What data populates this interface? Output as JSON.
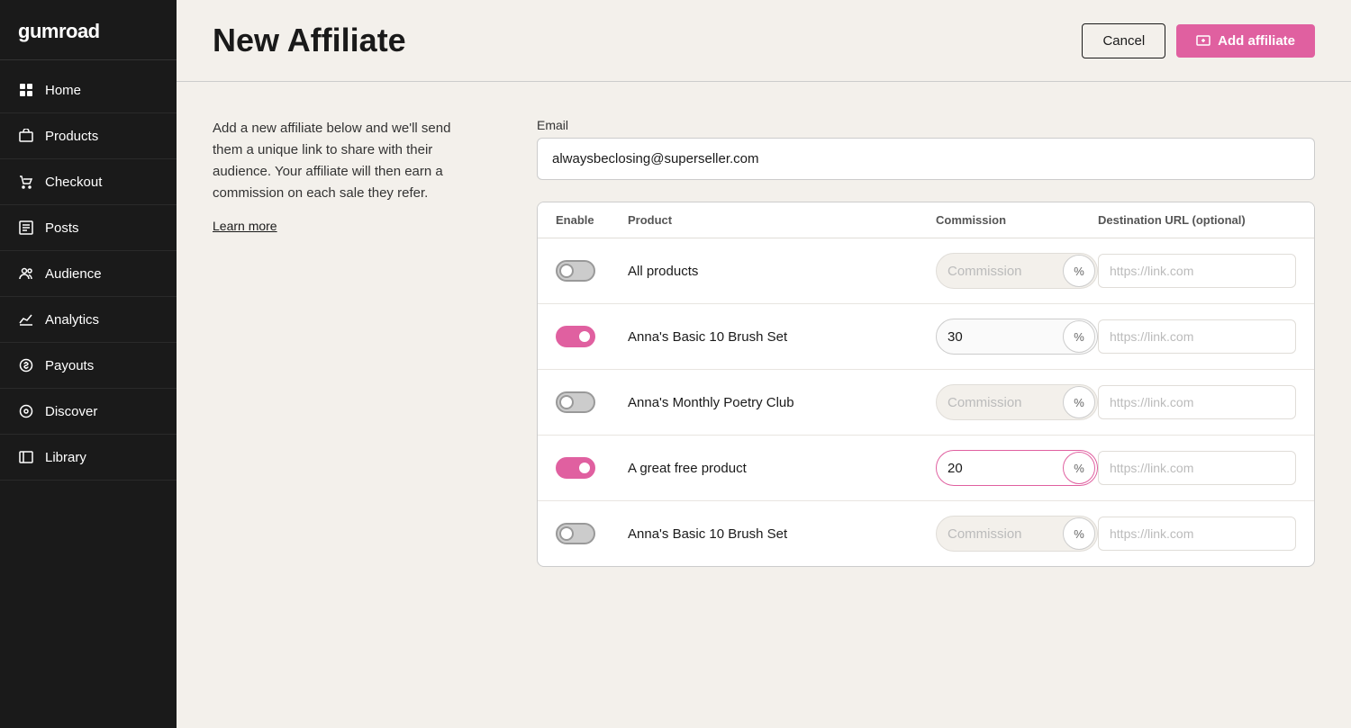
{
  "app": {
    "logo": "gumroad"
  },
  "sidebar": {
    "items": [
      {
        "id": "home",
        "label": "Home",
        "icon": "home-icon"
      },
      {
        "id": "products",
        "label": "Products",
        "icon": "products-icon"
      },
      {
        "id": "checkout",
        "label": "Checkout",
        "icon": "checkout-icon"
      },
      {
        "id": "posts",
        "label": "Posts",
        "icon": "posts-icon"
      },
      {
        "id": "audience",
        "label": "Audience",
        "icon": "audience-icon"
      },
      {
        "id": "analytics",
        "label": "Analytics",
        "icon": "analytics-icon"
      },
      {
        "id": "payouts",
        "label": "Payouts",
        "icon": "payouts-icon"
      },
      {
        "id": "discover",
        "label": "Discover",
        "icon": "discover-icon"
      },
      {
        "id": "library",
        "label": "Library",
        "icon": "library-icon"
      }
    ]
  },
  "header": {
    "title": "New Affiliate",
    "cancel_label": "Cancel",
    "add_label": "Add affiliate"
  },
  "left_panel": {
    "description": "Add a new affiliate below and we'll send them a unique link to share with their audience. Your affiliate will then earn a commission on each sale they refer.",
    "learn_more": "Learn more"
  },
  "form": {
    "email_label": "Email",
    "email_value": "alwaysbeclosing@superseller.com",
    "email_placeholder": ""
  },
  "table": {
    "headers": [
      "Enable",
      "Product",
      "Commission",
      "Destination URL (optional)"
    ],
    "rows": [
      {
        "id": "all-products",
        "enabled": false,
        "product": "All products",
        "commission": "",
        "commission_placeholder": "Commission",
        "url_placeholder": "https://link.com",
        "active": false
      },
      {
        "id": "anna-brush-set",
        "enabled": true,
        "product": "Anna's Basic 10 Brush Set",
        "commission": "30",
        "commission_placeholder": "Commission",
        "url_placeholder": "https://link.com",
        "active": false
      },
      {
        "id": "anna-poetry-club",
        "enabled": false,
        "product": "Anna's Monthly Poetry Club",
        "commission": "",
        "commission_placeholder": "Commission",
        "url_placeholder": "https://link.com",
        "active": false
      },
      {
        "id": "great-free-product",
        "enabled": true,
        "product": "A great free product",
        "commission": "20",
        "commission_placeholder": "Commission",
        "url_placeholder": "https://link.com",
        "active": true
      },
      {
        "id": "anna-brush-set-2",
        "enabled": false,
        "product": "Anna's Basic 10 Brush Set",
        "commission": "",
        "commission_placeholder": "Commission",
        "url_placeholder": "https://link.com",
        "active": false
      }
    ]
  }
}
